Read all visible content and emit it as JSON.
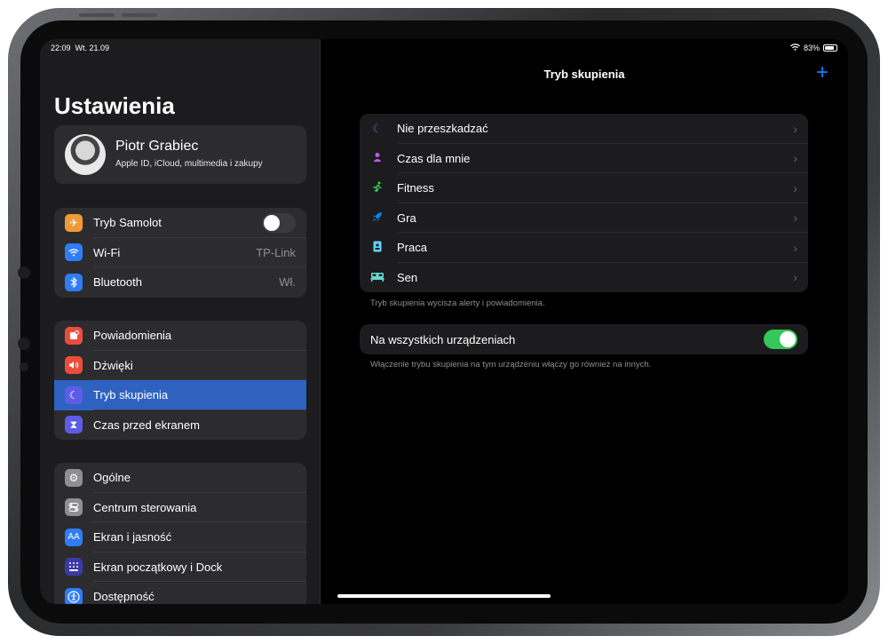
{
  "status_bar": {
    "time": "22:09",
    "date": "Wt. 21.09",
    "battery": "83%"
  },
  "sidebar": {
    "title": "Ustawienia",
    "profile": {
      "name": "Piotr Grabiec",
      "subtitle": "Apple ID, iCloud, multimedia i zakupy"
    },
    "group1": [
      {
        "label": "Tryb Samolot",
        "icon": "airplane-icon",
        "color": "#f09a37",
        "toggle": false
      },
      {
        "label": "Wi-Fi",
        "value": "TP-Link",
        "icon": "wifi-icon",
        "color": "#2f7cf6"
      },
      {
        "label": "Bluetooth",
        "value": "Wł.",
        "icon": "bluetooth-icon",
        "color": "#2f7cf6"
      }
    ],
    "group2": [
      {
        "label": "Powiadomienia",
        "icon": "notifications-icon",
        "color": "#eb4d3d"
      },
      {
        "label": "Dźwięki",
        "icon": "sound-icon",
        "color": "#eb4d3d"
      },
      {
        "label": "Tryb skupienia",
        "icon": "moon-icon",
        "color": "#5e5ce6",
        "selected": true
      },
      {
        "label": "Czas przed ekranem",
        "icon": "hourglass-icon",
        "color": "#5e5ce6"
      }
    ],
    "group3": [
      {
        "label": "Ogólne",
        "icon": "gear-icon",
        "color": "#8e8e93"
      },
      {
        "label": "Centrum sterowania",
        "icon": "control-center-icon",
        "color": "#8e8e93"
      },
      {
        "label": "Ekran i jasność",
        "icon": "display-icon",
        "color": "#2f7cf6"
      },
      {
        "label": "Ekran początkowy i Dock",
        "icon": "home-screen-icon",
        "color": "#3a3aa8"
      },
      {
        "label": "Dostępność",
        "icon": "accessibility-icon",
        "color": "#2f7cf6"
      }
    ]
  },
  "detail": {
    "title": "Tryb skupienia",
    "focus_modes": [
      {
        "label": "Nie przeszkadzać",
        "icon": "moon-icon",
        "color": "#5e5ce6"
      },
      {
        "label": "Czas dla mnie",
        "icon": "person-icon",
        "color": "#bf5af2"
      },
      {
        "label": "Fitness",
        "icon": "running-icon",
        "color": "#30d158"
      },
      {
        "label": "Gra",
        "icon": "rocket-icon",
        "color": "#0a84ff"
      },
      {
        "label": "Praca",
        "icon": "badge-icon",
        "color": "#64d2ff"
      },
      {
        "label": "Sen",
        "icon": "bed-icon",
        "color": "#66d4cf"
      }
    ],
    "focus_note": "Tryb skupienia wycisza alerty i powiadomienia.",
    "share_label": "Na wszystkich urządzeniach",
    "share_toggle": true,
    "share_note": "Włączenie trybu skupienia na tym urządzeniu włączy go również na innych."
  }
}
